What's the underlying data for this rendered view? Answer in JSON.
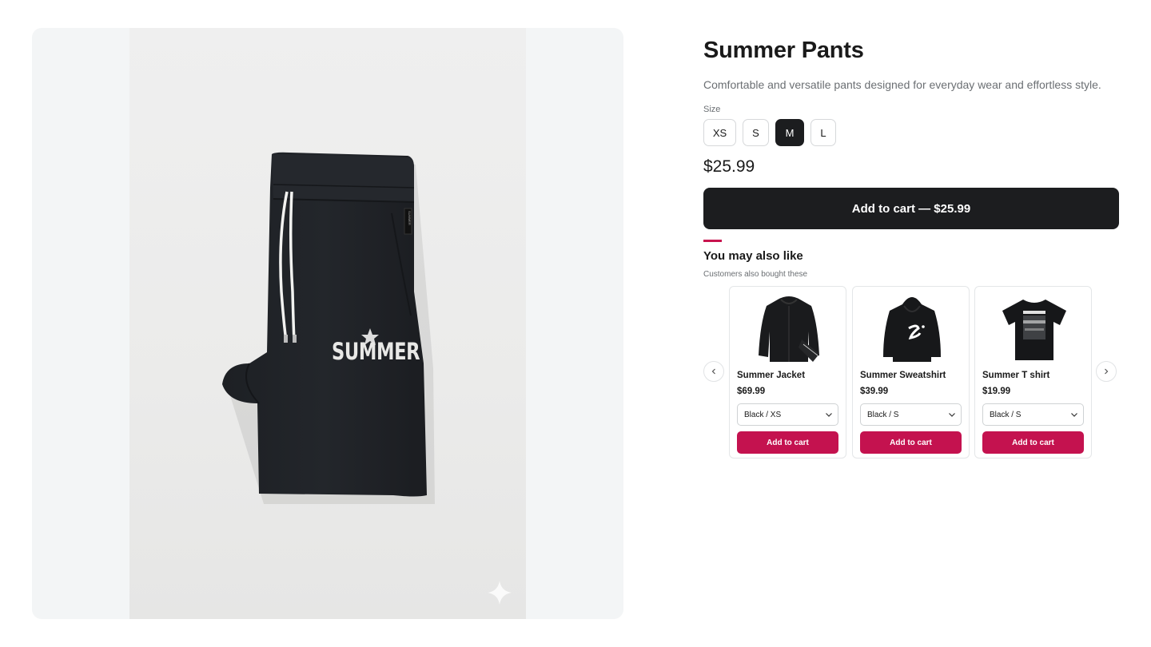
{
  "product": {
    "title": "Summer Pants",
    "description": "Comfortable and versatile pants designed for everyday wear and effortless style.",
    "size_label": "Size",
    "sizes": [
      {
        "label": "XS",
        "selected": false
      },
      {
        "label": "S",
        "selected": false
      },
      {
        "label": "M",
        "selected": true
      },
      {
        "label": "L",
        "selected": false
      }
    ],
    "price": "$25.99",
    "add_to_cart_label": "Add to cart — $25.99",
    "image": {
      "print_text": "SUMMER",
      "waistband_tag": "SUMMER"
    }
  },
  "recommendations": {
    "title": "You may also like",
    "subtitle": "Customers also bought these",
    "prev_icon": "chevron-left-icon",
    "next_icon": "chevron-right-icon",
    "items": [
      {
        "name": "Summer Jacket",
        "price": "$69.99",
        "variant": "Black / XS",
        "cta": "Add to cart",
        "image": "jacket"
      },
      {
        "name": "Summer Sweatshirt",
        "price": "$39.99",
        "variant": "Black / S",
        "cta": "Add to cart",
        "image": "hoodie"
      },
      {
        "name": "Summer T shirt",
        "price": "$19.99",
        "variant": "Black / S",
        "cta": "Add to cart",
        "image": "tshirt"
      }
    ]
  },
  "colors": {
    "accent": "#c4124f",
    "primary_button": "#1c1d1f",
    "panel_bg": "#f3f5f6"
  }
}
